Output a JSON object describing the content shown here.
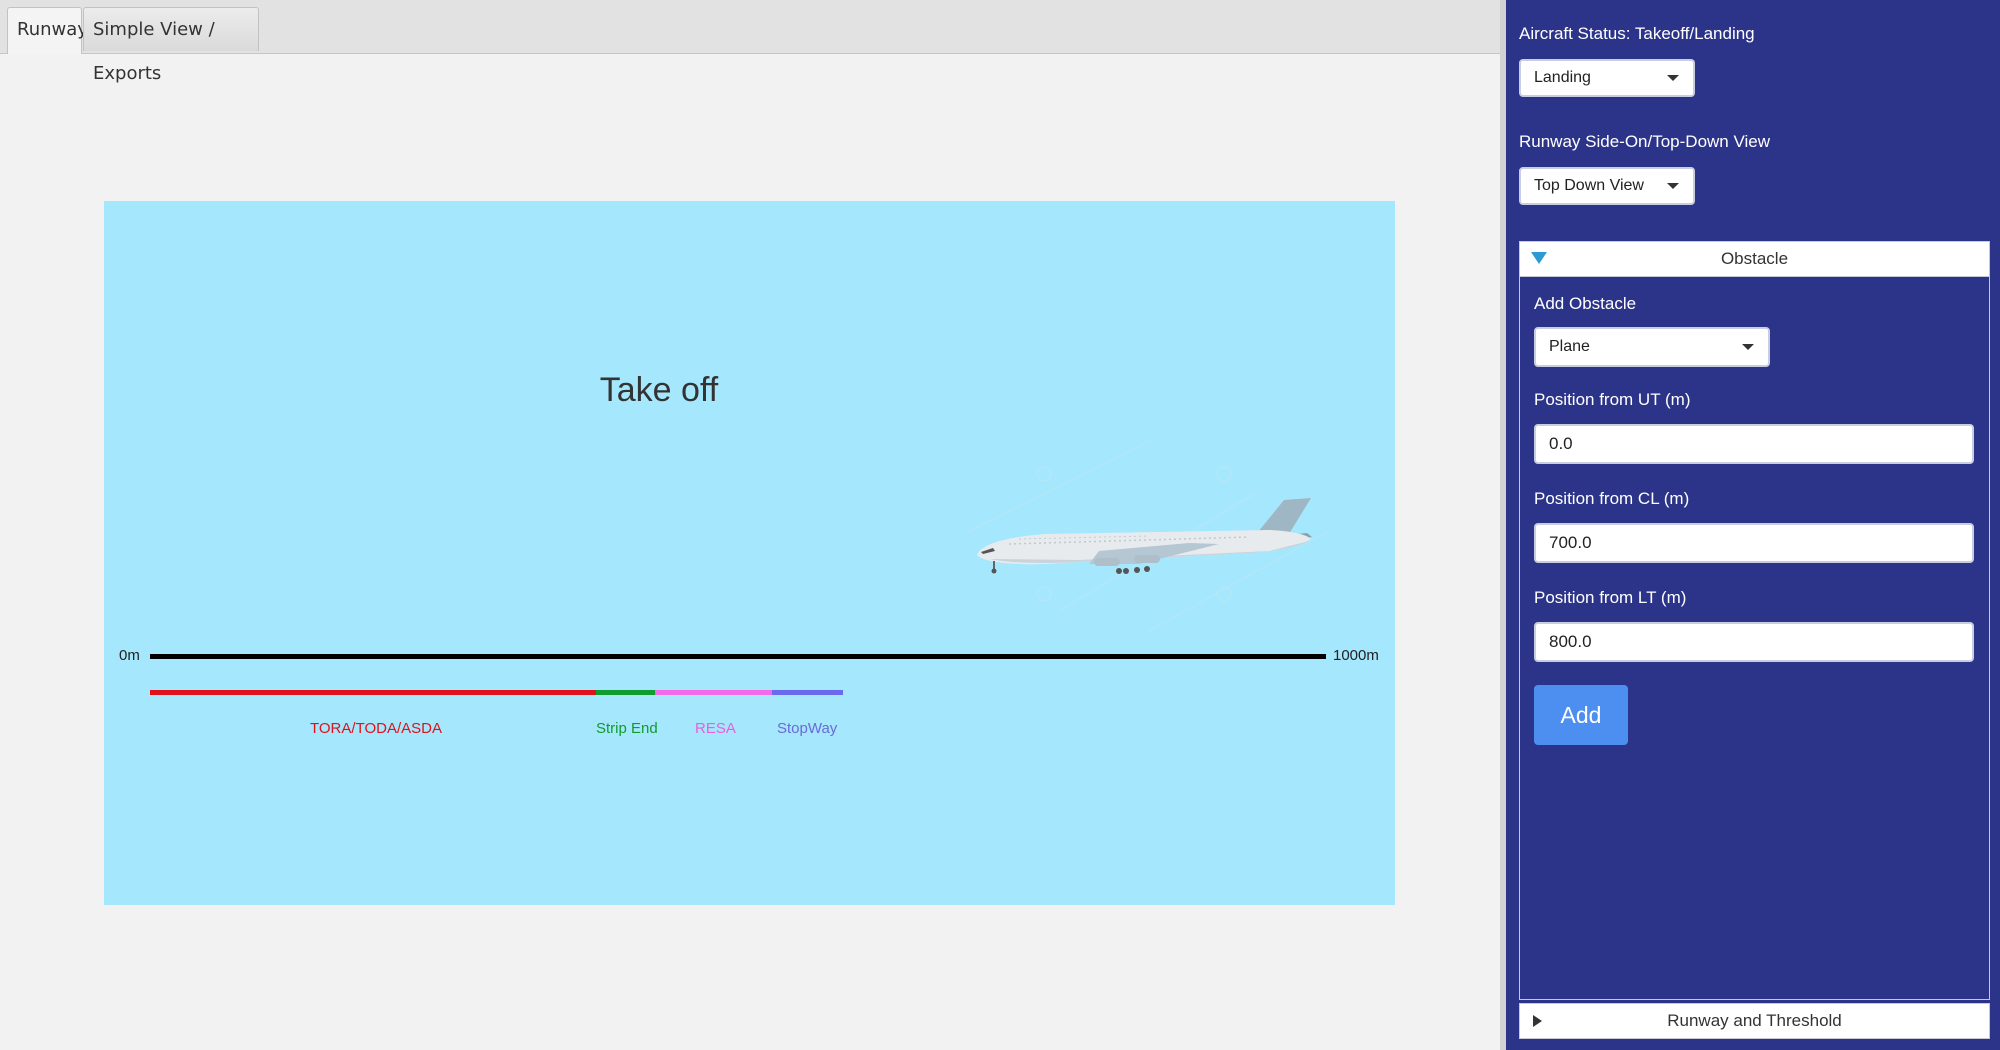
{
  "tabs": [
    {
      "label": "Runway",
      "active": true
    },
    {
      "label": "Simple View / Exports",
      "active": false
    }
  ],
  "runway_view": {
    "title": "Take off",
    "background_color": "#a5e7fd",
    "axis": {
      "start_label": "0m",
      "end_label": "1000m"
    },
    "segments": [
      {
        "label": "TORA/TODA/ASDA",
        "color": "#e0101c"
      },
      {
        "label": "Strip End",
        "color": "#109b2e"
      },
      {
        "label": "RESA",
        "color": "#f06ce8"
      },
      {
        "label": "StopWay",
        "color": "#6a6af0"
      }
    ],
    "obstacle_image": "plane-icon"
  },
  "side_panel": {
    "background_color": "#2c3489",
    "aircraft_status": {
      "label": "Aircraft Status: Takeoff/Landing",
      "value": "Landing"
    },
    "runway_view_select": {
      "label": "Runway Side-On/Top-Down View",
      "value": "Top Down View"
    },
    "obstacle_section": {
      "title": "Obstacle",
      "expanded": true,
      "add_obstacle": {
        "label": "Add Obstacle",
        "value": "Plane"
      },
      "fields": [
        {
          "label": "Position from UT (m)",
          "value": "0.0"
        },
        {
          "label": "Position from CL (m)",
          "value": "700.0"
        },
        {
          "label": "Position from LT (m)",
          "value": "800.0"
        }
      ],
      "add_button": "Add",
      "add_button_color": "#4d8ff0"
    },
    "runway_section": {
      "title": "Runway and Threshold",
      "expanded": false
    }
  }
}
